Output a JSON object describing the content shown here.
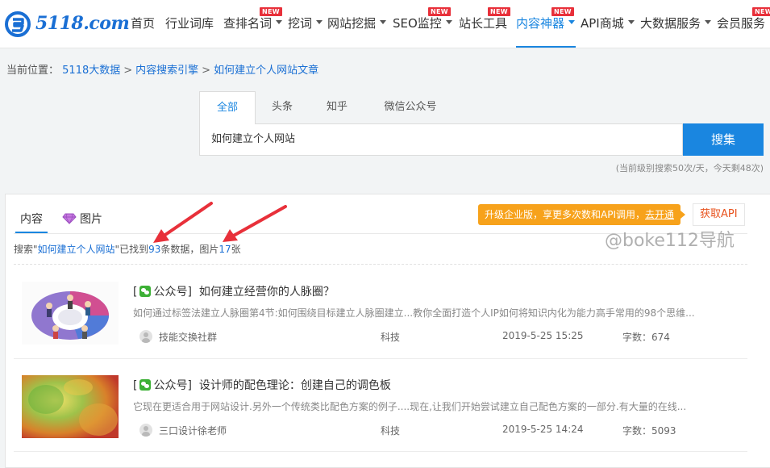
{
  "brand": {
    "logo_text": "5118.com"
  },
  "nav": [
    {
      "label": "首页",
      "caret": false,
      "badge": ""
    },
    {
      "label": "行业词库",
      "caret": false,
      "badge": ""
    },
    {
      "label": "查排名词",
      "caret": true,
      "badge": "NEW"
    },
    {
      "label": "挖词",
      "caret": true,
      "badge": ""
    },
    {
      "label": "网站挖掘",
      "caret": true,
      "badge": ""
    },
    {
      "label": "SEO监控",
      "caret": true,
      "badge": "NEW"
    },
    {
      "label": "站长工具",
      "caret": false,
      "badge": "NEW"
    },
    {
      "label": "内容神器",
      "caret": true,
      "badge": "NEW",
      "active": true
    },
    {
      "label": "API商城",
      "caret": true,
      "badge": ""
    },
    {
      "label": "大数据服务",
      "caret": true,
      "badge": ""
    },
    {
      "label": "会员服务",
      "caret": false,
      "badge": "NEW"
    }
  ],
  "breadcrumb": {
    "prefix": "当前位置：",
    "items": [
      "5118大数据",
      "内容搜索引擎",
      "如何建立个人网站文章"
    ],
    "separator": ">"
  },
  "search": {
    "tabs": [
      "全部",
      "头条",
      "知乎",
      "微信公众号"
    ],
    "active_tab": 0,
    "query": "如何建立个人网站",
    "button": "搜集",
    "quota": "(当前级别搜索50次/天，今天剩48次)"
  },
  "results_panel": {
    "tabs": [
      "内容",
      "图片"
    ],
    "promo_text": "升级企业版，享更多次数和API调用，",
    "promo_link": "去开通",
    "api_button": "获取API",
    "summary": {
      "prefix": "搜索\"",
      "keyword": "如何建立个人网站",
      "mid": "\"已找到",
      "count": "93",
      "mid2": "条数据，图片",
      "images": "17",
      "suffix": "张"
    }
  },
  "results": [
    {
      "bracket_open": "[",
      "source": "公众号]",
      "title": "如何建立经营你的人脉圈？",
      "desc": "如何通过标签法建立人脉圈第4节:如何围绕目标建立人脉圈建立...教你全面打造个人IP如何将知识内化为能力高手常用的98个思维...",
      "author": "技能交换社群",
      "category": "科技",
      "date": "2019-5-25 15:25",
      "words": "字数：674"
    },
    {
      "bracket_open": "[",
      "source": "公众号]",
      "title": "设计师的配色理论：创建自己的调色板",
      "desc": "它现在更适合用于网站设计.另外一个传统类比配色方案的例子....现在,让我们开始尝试建立自己配色方案的一部分.有大量的在线...",
      "author": "三口设计徐老师",
      "category": "科技",
      "date": "2019-5-25 14:24",
      "words": "字数：5093"
    }
  ],
  "watermark": "@boke112导航",
  "colors": {
    "accent": "#1a86e0",
    "badge": "#e8303a",
    "promo": "#f7a21b",
    "api": "#e8531e",
    "arrow": "#e8303a"
  }
}
